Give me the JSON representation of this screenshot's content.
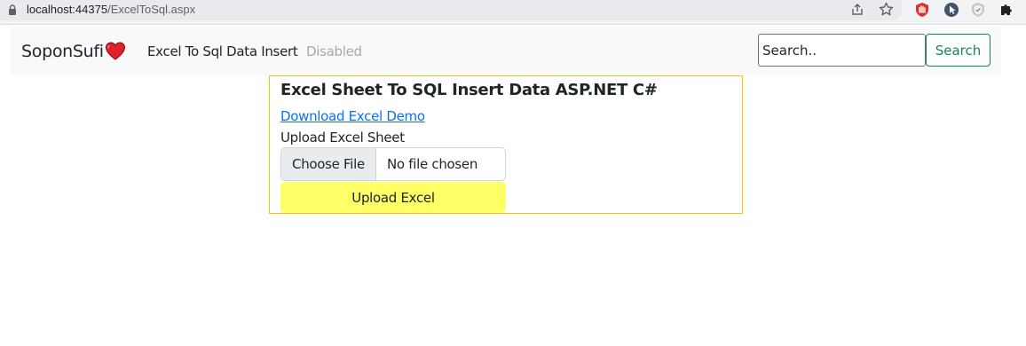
{
  "browser": {
    "url_host": "localhost:44375",
    "url_path": "/ExcelToSql.aspx",
    "icons": [
      "lock-icon",
      "share-icon",
      "star-icon",
      "shield-extension-icon",
      "cursor-extension-icon",
      "badge-extension-icon",
      "puzzle-extensions-icon"
    ]
  },
  "navbar": {
    "brand": "SoponSufi",
    "brand_icon": "heart-icon",
    "links": {
      "active": "Excel To Sql Data Insert",
      "disabled": "Disabled"
    },
    "search": {
      "placeholder": "Search..",
      "button_label": "Search"
    }
  },
  "card": {
    "title": "Excel Sheet To SQL Insert Data ASP.NET C#",
    "download_link": "Download Excel Demo",
    "upload_label": "Upload Excel Sheet",
    "file_input": {
      "choose_label": "Choose File",
      "status": "No file chosen"
    },
    "upload_button": "Upload Excel"
  },
  "colors": {
    "card_border": "#ffc107",
    "upload_button_bg": "#ffff66",
    "search_button": "#198754",
    "link": "#0d6efd",
    "heart": "#e0202a"
  }
}
